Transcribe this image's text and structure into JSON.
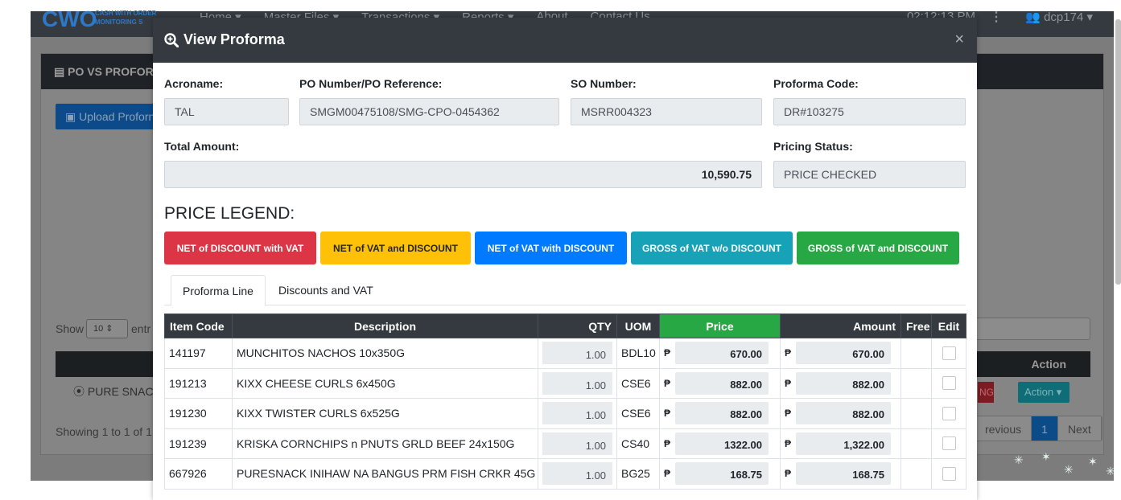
{
  "app": {
    "logo": "CWO",
    "logo_sub_1": "CASH WITH ORDER",
    "logo_sub_2": "MONITORING S",
    "menu": [
      "Home ▾",
      "Master Files ▾",
      "Transactions ▾",
      "Reports ▾",
      "About",
      "Contact Us"
    ],
    "time": "02:12:13 PM",
    "user": "dcp174 ▾"
  },
  "background": {
    "card_title": "PO VS PROFORM",
    "upload_label": "Upload Proforn",
    "show_label": "Show",
    "show_value": "10",
    "entries_label": "entr",
    "action_header": "Action",
    "row_text": "PURE SNACK",
    "red_badge": "NG",
    "action_button": "Action ▾",
    "showing": "Showing 1 to 1 of 1",
    "pagination": [
      "revious",
      "1",
      "Next"
    ]
  },
  "modal": {
    "title": "View Proforma",
    "fields": {
      "acroname_label": "Acroname:",
      "acroname": "TAL",
      "po_label": "PO Number/PO Reference:",
      "po": "SMGM00475108/SMG-CPO-0454362",
      "so_label": "SO Number:",
      "so": "MSRR004323",
      "proforma_label": "Proforma Code:",
      "proforma": "DR#103275",
      "total_label": "Total Amount:",
      "total": "10,590.75",
      "pricing_label": "Pricing Status:",
      "pricing": "PRICE CHECKED"
    },
    "legend_title": "PRICE LEGEND:",
    "legend": [
      {
        "label": "NET of DISCOUNT with VAT",
        "color": "#dc3545",
        "text_color": "#ffffff"
      },
      {
        "label": "NET of VAT and DISCOUNT",
        "color": "#ffc107",
        "text_color": "#212529"
      },
      {
        "label": "NET of VAT with DISCOUNT",
        "color": "#007bff",
        "text_color": "#ffffff"
      },
      {
        "label": "GROSS of VAT w/o DISCOUNT",
        "color": "#17a2b8",
        "text_color": "#ffffff"
      },
      {
        "label": "GROSS of VAT and DISCOUNT",
        "color": "#28a745",
        "text_color": "#ffffff"
      }
    ],
    "tabs": [
      "Proforma Line",
      "Discounts and VAT"
    ],
    "columns": [
      "Item Code",
      "Description",
      "QTY",
      "UOM",
      "Price",
      "Amount",
      "Free",
      "Edit"
    ],
    "currency": "₱",
    "rows": [
      {
        "code": "141197",
        "desc": "MUNCHITOS NACHOS 10x350G",
        "qty": "1.00",
        "uom": "BDL10",
        "price": "670.00",
        "amount": "670.00"
      },
      {
        "code": "191213",
        "desc": "KIXX CHEESE CURLS 6x450G",
        "qty": "1.00",
        "uom": "CSE6",
        "price": "882.00",
        "amount": "882.00"
      },
      {
        "code": "191230",
        "desc": "KIXX TWISTER CURLS 6x525G",
        "qty": "1.00",
        "uom": "CSE6",
        "price": "882.00",
        "amount": "882.00"
      },
      {
        "code": "191239",
        "desc": "KRISKA CORNCHIPS n PNUTS GRLD BEEF 24x150G",
        "qty": "1.00",
        "uom": "CS40",
        "price": "1322.00",
        "amount": "1,322.00"
      },
      {
        "code": "667926",
        "desc": "PURESNACK INIHAW NA BANGUS PRM FISH CRKR 45G",
        "qty": "1.00",
        "uom": "BG25",
        "price": "168.75",
        "amount": "168.75"
      }
    ]
  }
}
